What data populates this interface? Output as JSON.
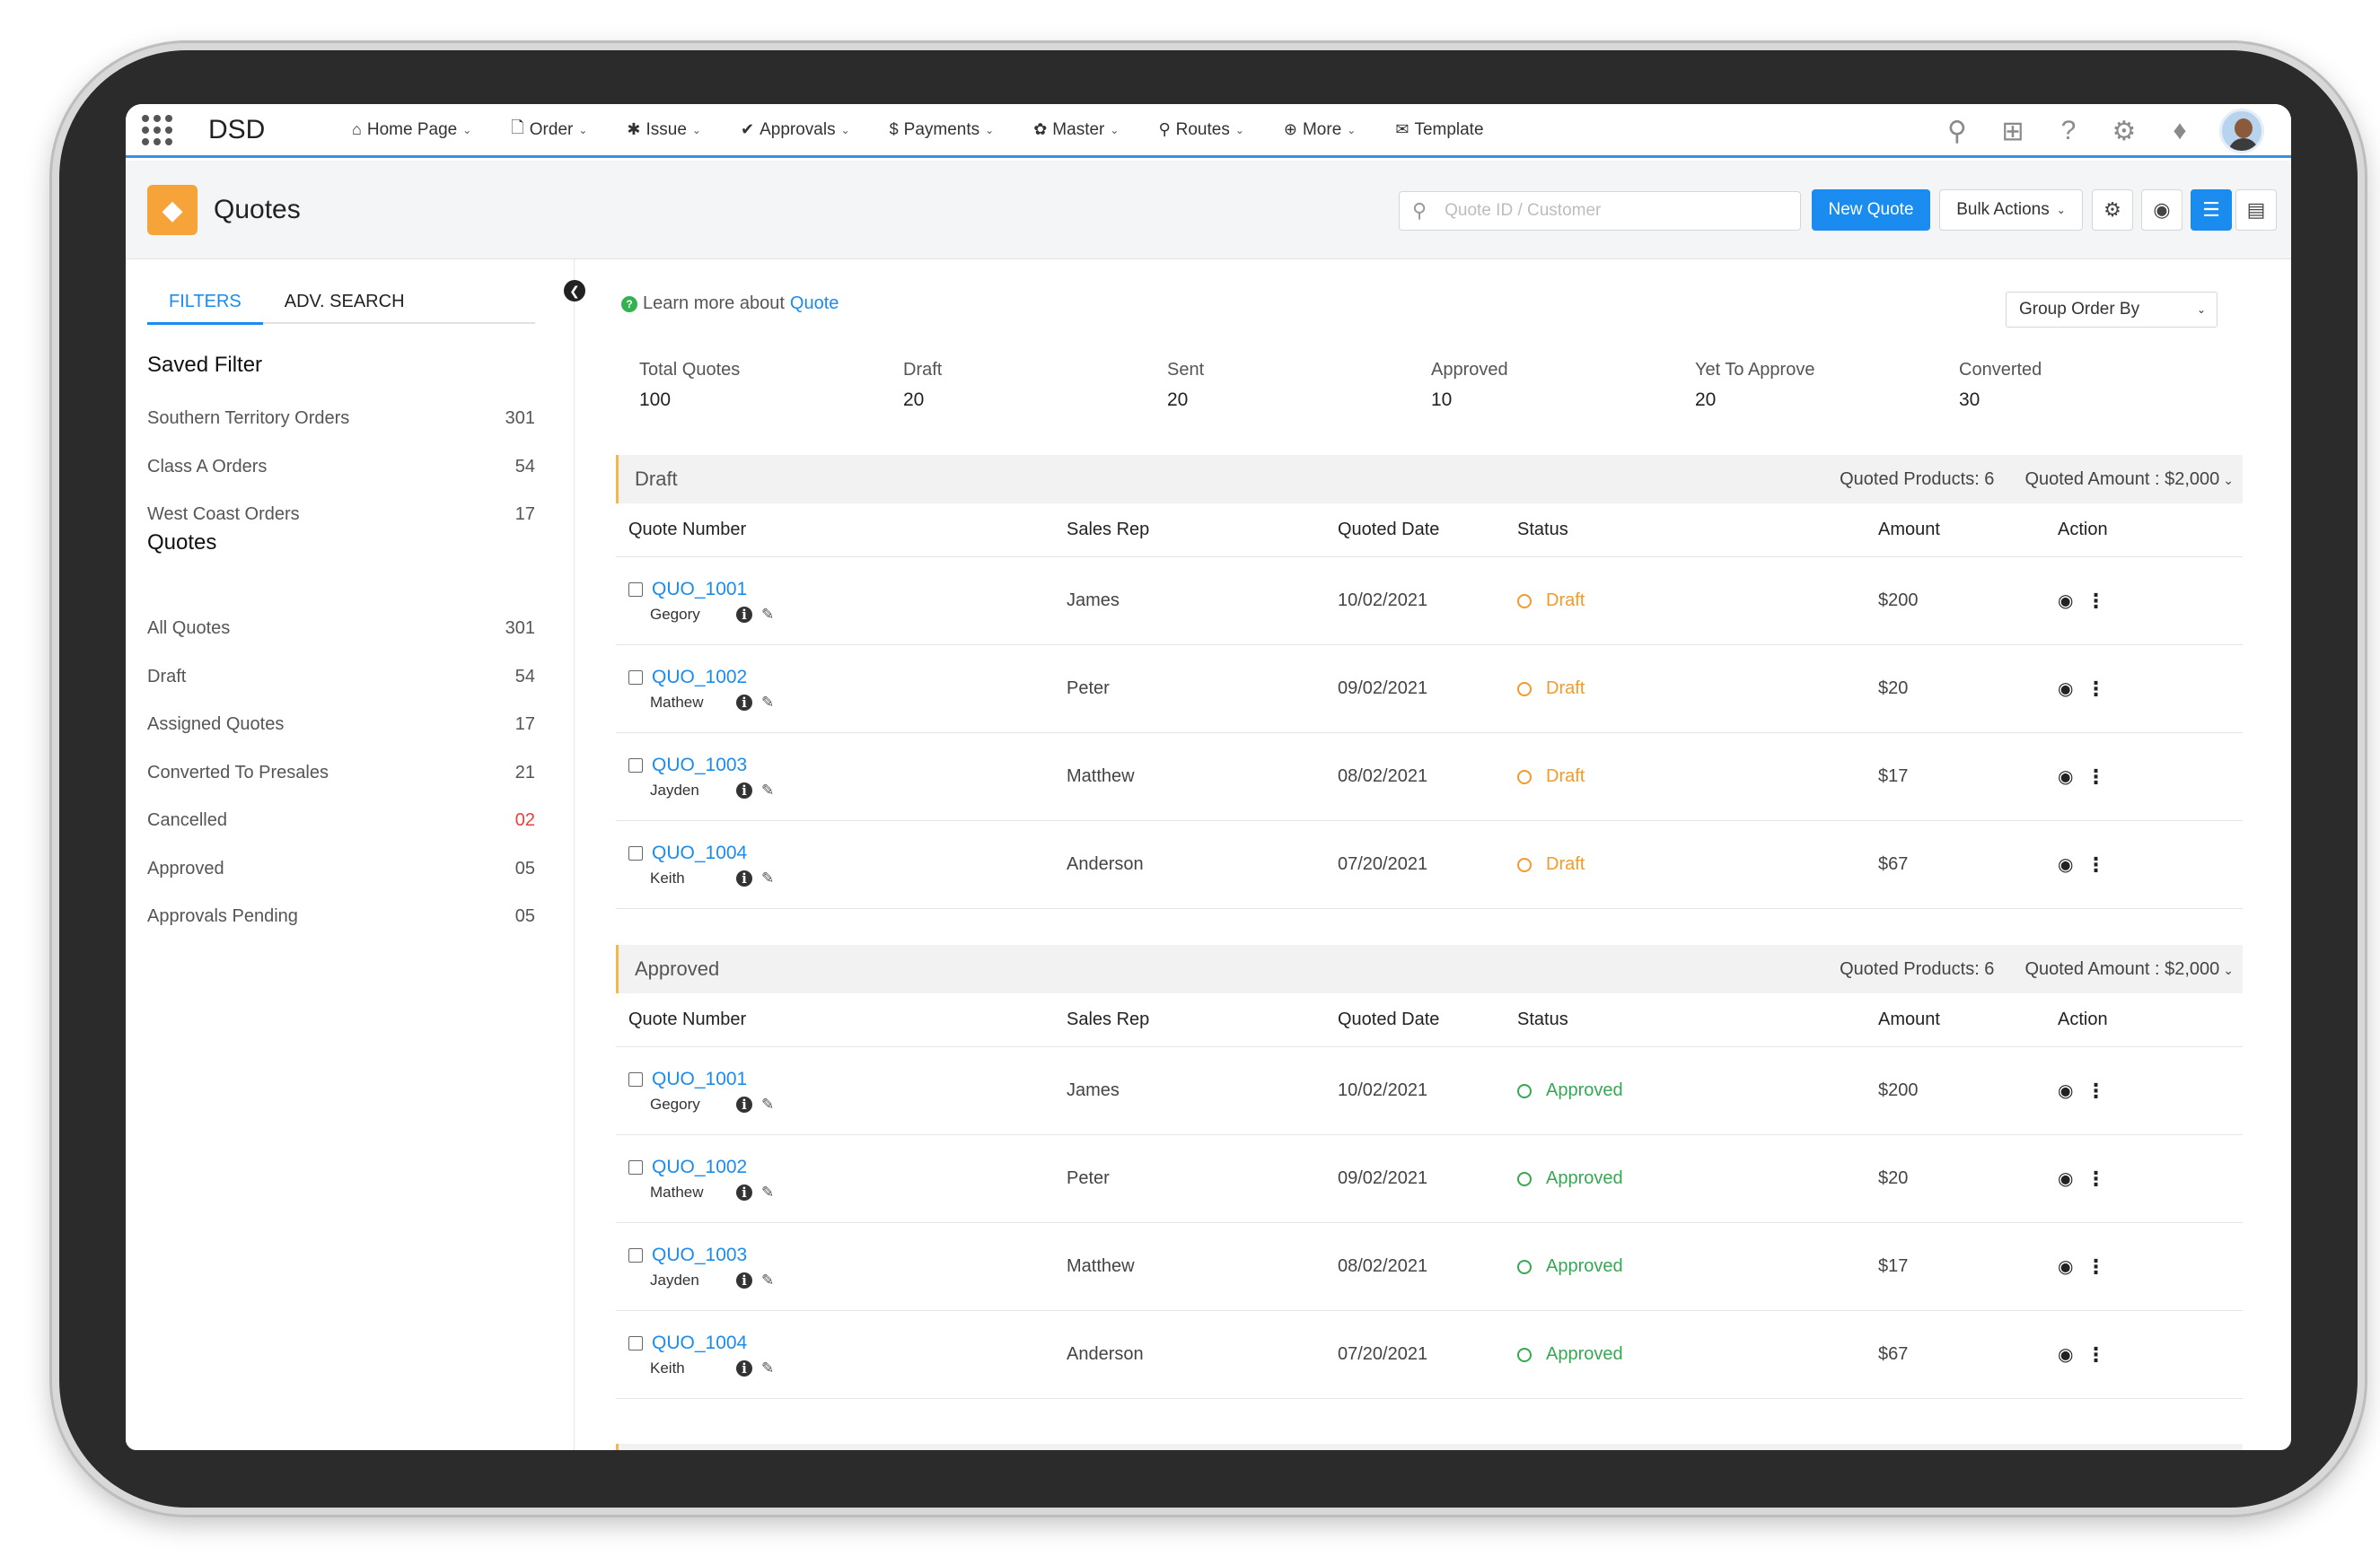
{
  "app": {
    "brand": "DSD",
    "nav": [
      {
        "icon": "home-icon",
        "glyph": "⌂",
        "label": "Home Page"
      },
      {
        "icon": "file-icon",
        "glyph": "🗋",
        "label": "Order"
      },
      {
        "icon": "issue-icon",
        "glyph": "✱",
        "label": "Issue"
      },
      {
        "icon": "check-icon",
        "glyph": "✔",
        "label": "Approvals"
      },
      {
        "icon": "dollar-icon",
        "glyph": "$",
        "label": "Payments"
      },
      {
        "icon": "gear-icon",
        "glyph": "✿",
        "label": "Master"
      },
      {
        "icon": "map-pin-icon",
        "glyph": "⚲",
        "label": "Routes"
      },
      {
        "icon": "plus-circle-icon",
        "glyph": "⊕",
        "label": "More"
      },
      {
        "icon": "envelope-icon",
        "glyph": "✉",
        "label": "Template"
      }
    ]
  },
  "header": {
    "title": "Quotes",
    "search_placeholder": "Quote ID / Customer",
    "new_button": "New Quote",
    "bulk_button": "Bulk Actions"
  },
  "sidebar": {
    "tabs": [
      "FILTERS",
      "ADV. SEARCH"
    ],
    "saved_title": "Saved Filter",
    "saved": [
      {
        "label": "Southern Territory Orders",
        "count": "301"
      },
      {
        "label": "Class A Orders",
        "count": "54"
      },
      {
        "label": "West Coast Orders",
        "count": "17"
      }
    ],
    "quotes_title": "Quotes",
    "quotes": [
      {
        "label": "All Quotes",
        "count": "301"
      },
      {
        "label": "Draft",
        "count": "54"
      },
      {
        "label": "Assigned Quotes",
        "count": "17"
      },
      {
        "label": "Converted To Presales",
        "count": "21"
      },
      {
        "label": "Cancelled",
        "count": "02"
      },
      {
        "label": "Approved",
        "count": "05"
      },
      {
        "label": "Approvals Pending",
        "count": "05"
      }
    ]
  },
  "main": {
    "learn_text": "Learn more about",
    "learn_link": "Quote",
    "group_by": "Group Order By",
    "stats": [
      {
        "label": "Total Quotes",
        "value": "100"
      },
      {
        "label": "Draft",
        "value": "20"
      },
      {
        "label": "Sent",
        "value": "20"
      },
      {
        "label": "Approved",
        "value": "10"
      },
      {
        "label": "Yet To Approve",
        "value": "20"
      },
      {
        "label": "Converted",
        "value": "30"
      }
    ],
    "columns": [
      "Quote Number",
      "Sales Rep",
      "Quoted Date",
      "Status",
      "Amount",
      "Action"
    ],
    "groups": [
      {
        "name": "Draft",
        "products": "Quoted Products: 6",
        "amount": "Quoted Amount : $2,000",
        "rows": [
          {
            "number": "QUO_1001",
            "owner": "Gegory",
            "rep": "James",
            "date": "10/02/2021",
            "status": "Draft",
            "amount": "$200"
          },
          {
            "number": "QUO_1002",
            "owner": "Mathew",
            "rep": "Peter",
            "date": "09/02/2021",
            "status": "Draft",
            "amount": "$20"
          },
          {
            "number": "QUO_1003",
            "owner": "Jayden",
            "rep": "Matthew",
            "date": "08/02/2021",
            "status": "Draft",
            "amount": "$17"
          },
          {
            "number": "QUO_1004",
            "owner": "Keith",
            "rep": "Anderson",
            "date": "07/20/2021",
            "status": "Draft",
            "amount": "$67"
          }
        ]
      },
      {
        "name": "Approved",
        "products": "Quoted Products: 6",
        "amount": "Quoted Amount : $2,000",
        "rows": [
          {
            "number": "QUO_1001",
            "owner": "Gegory",
            "rep": "James",
            "date": "10/02/2021",
            "status": "Approved",
            "amount": "$200"
          },
          {
            "number": "QUO_1002",
            "owner": "Mathew",
            "rep": "Peter",
            "date": "09/02/2021",
            "status": "Approved",
            "amount": "$20"
          },
          {
            "number": "QUO_1003",
            "owner": "Jayden",
            "rep": "Matthew",
            "date": "08/02/2021",
            "status": "Approved",
            "amount": "$17"
          },
          {
            "number": "QUO_1004",
            "owner": "Keith",
            "rep": "Anderson",
            "date": "07/20/2021",
            "status": "Approved",
            "amount": "$67"
          }
        ]
      }
    ]
  },
  "colors": {
    "accent": "#1a8cf0",
    "draft": "#f39a2b",
    "approved": "#36a853",
    "alert": "#e8413b"
  }
}
